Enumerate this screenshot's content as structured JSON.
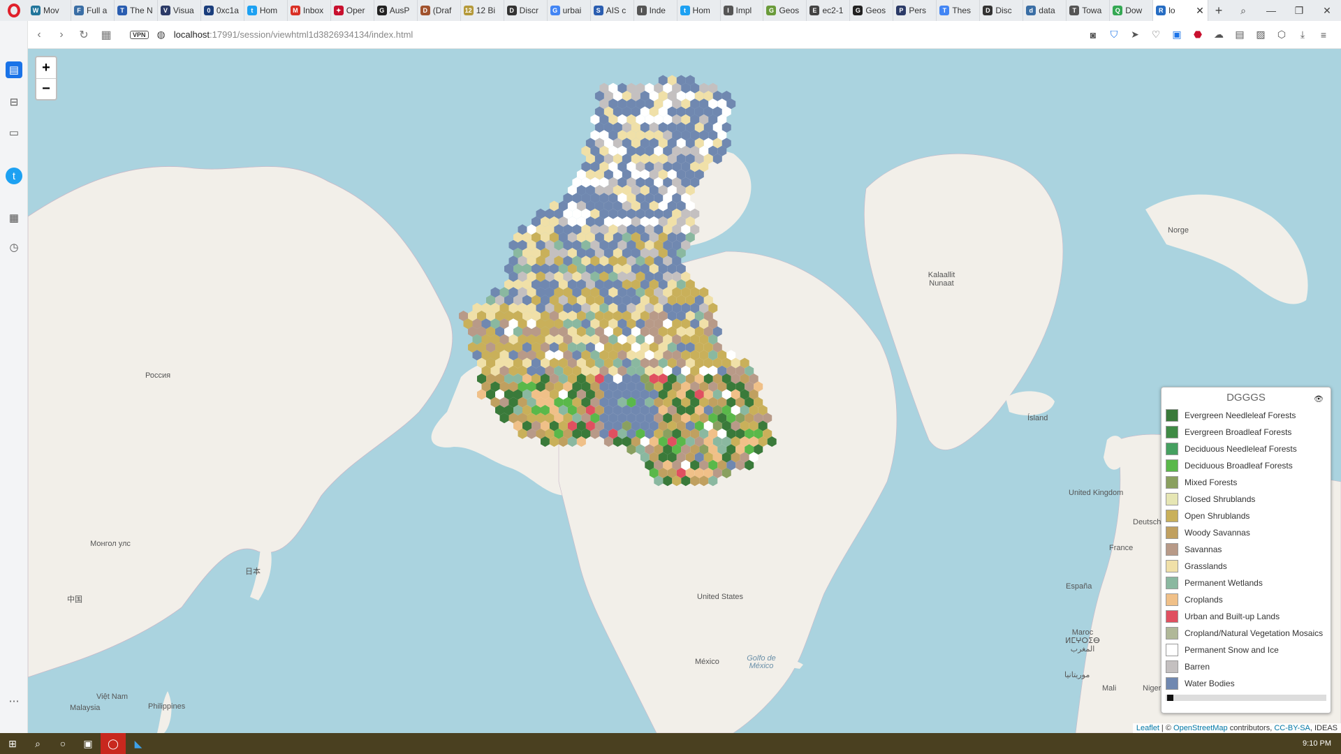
{
  "tabs": [
    {
      "label": "Mov",
      "color": "#21759b",
      "glyph": "W"
    },
    {
      "label": "Full a",
      "color": "#3a6ea5",
      "glyph": "F"
    },
    {
      "label": "The N",
      "color": "#2a5db0",
      "glyph": "T"
    },
    {
      "label": "Visua",
      "color": "#2b3a67",
      "glyph": "V"
    },
    {
      "label": "0xc1a",
      "color": "#1a3d7c",
      "glyph": "0"
    },
    {
      "label": "Hom",
      "color": "#1da1f2",
      "glyph": "t"
    },
    {
      "label": "Inbox",
      "color": "#d93025",
      "glyph": "M"
    },
    {
      "label": "Oper",
      "color": "#c8102e",
      "glyph": "✦"
    },
    {
      "label": "AusP",
      "color": "#222222",
      "glyph": "G"
    },
    {
      "label": "(Draf",
      "color": "#a0522d",
      "glyph": "D"
    },
    {
      "label": "12 Bi",
      "color": "#b59a3b",
      "glyph": "12"
    },
    {
      "label": "Discr",
      "color": "#333333",
      "glyph": "D"
    },
    {
      "label": "urbai",
      "color": "#4285f4",
      "glyph": "G"
    },
    {
      "label": "AIS c",
      "color": "#2a5db0",
      "glyph": "S"
    },
    {
      "label": "Inde",
      "color": "#555555",
      "glyph": "I"
    },
    {
      "label": "Hom",
      "color": "#1da1f2",
      "glyph": "t"
    },
    {
      "label": "Impl",
      "color": "#555555",
      "glyph": "I"
    },
    {
      "label": "Geos",
      "color": "#6a9b3a",
      "glyph": "G"
    },
    {
      "label": "ec2-1",
      "color": "#444444",
      "glyph": "E"
    },
    {
      "label": "Geos",
      "color": "#222222",
      "glyph": "G"
    },
    {
      "label": "Pers",
      "color": "#2b3a67",
      "glyph": "P"
    },
    {
      "label": "Thes",
      "color": "#4285f4",
      "glyph": "T"
    },
    {
      "label": "Disc",
      "color": "#333333",
      "glyph": "D"
    },
    {
      "label": "data",
      "color": "#3a6ea5",
      "glyph": "d"
    },
    {
      "label": "Towa",
      "color": "#555555",
      "glyph": "T"
    },
    {
      "label": "Dow",
      "color": "#34a853",
      "glyph": "Q"
    },
    {
      "label": "lo",
      "color": "#276dc3",
      "glyph": "R"
    }
  ],
  "address": {
    "vpn": "VPN",
    "host": "localhost",
    "path": ":17991/session/viewhtml1d3826934134/index.html"
  },
  "map": {
    "zoom_in": "+",
    "zoom_out": "−",
    "labels": {
      "russia": "Россия",
      "mongolia": "Монгол улс",
      "japan": "日本",
      "china": "中国",
      "vietnam": "Việt Nam",
      "philippines": "Philippines",
      "malaysia": "Malaysia",
      "kalaallit": "Kalaallit Nunaat",
      "norge": "Norge",
      "island": "Ísland",
      "uk": "United Kingdom",
      "deutschland": "Deutsch",
      "france": "France",
      "espana": "España",
      "maroc": "Maroc ⵍⵎⵖⵔⵉⴱ المغرب",
      "mauritanie": "موريتانيا",
      "mali": "Mali",
      "niger": "Niger",
      "us": "United States",
      "mexico": "México",
      "golfo": "Golfo de México"
    }
  },
  "legend": {
    "title": "DGGGS",
    "items": [
      {
        "label": "Evergreen Needleleaf Forests",
        "color": "#3a7a3a"
      },
      {
        "label": "Evergreen Broadleaf Forests",
        "color": "#3f8a45"
      },
      {
        "label": "Deciduous Needleleaf Forests",
        "color": "#45a060"
      },
      {
        "label": "Deciduous Broadleaf Forests",
        "color": "#5ab84a"
      },
      {
        "label": "Mixed Forests",
        "color": "#8aa060"
      },
      {
        "label": "Closed Shrublands",
        "color": "#e6e6b4"
      },
      {
        "label": "Open Shrublands",
        "color": "#c9b05a"
      },
      {
        "label": "Woody Savannas",
        "color": "#c0a060"
      },
      {
        "label": "Savannas",
        "color": "#b89a88"
      },
      {
        "label": "Grasslands",
        "color": "#f0e0a8"
      },
      {
        "label": "Permanent Wetlands",
        "color": "#8ab8a0"
      },
      {
        "label": "Croplands",
        "color": "#f0c088"
      },
      {
        "label": "Urban and Built-up Lands",
        "color": "#e05060"
      },
      {
        "label": "Cropland/Natural Vegetation Mosaics",
        "color": "#b0b898"
      },
      {
        "label": "Permanent Snow and Ice",
        "color": "#ffffff"
      },
      {
        "label": "Barren",
        "color": "#c4c0c0"
      },
      {
        "label": "Water Bodies",
        "color": "#7088b0"
      }
    ]
  },
  "attribution": {
    "leaflet": "Leaflet",
    "sep": " | © ",
    "osm": "OpenStreetMap",
    "contrib": " contributors, ",
    "cc": "CC-BY-SA",
    "ideas": ", IDEAS"
  },
  "taskbar": {
    "clock": "9:10 PM"
  }
}
